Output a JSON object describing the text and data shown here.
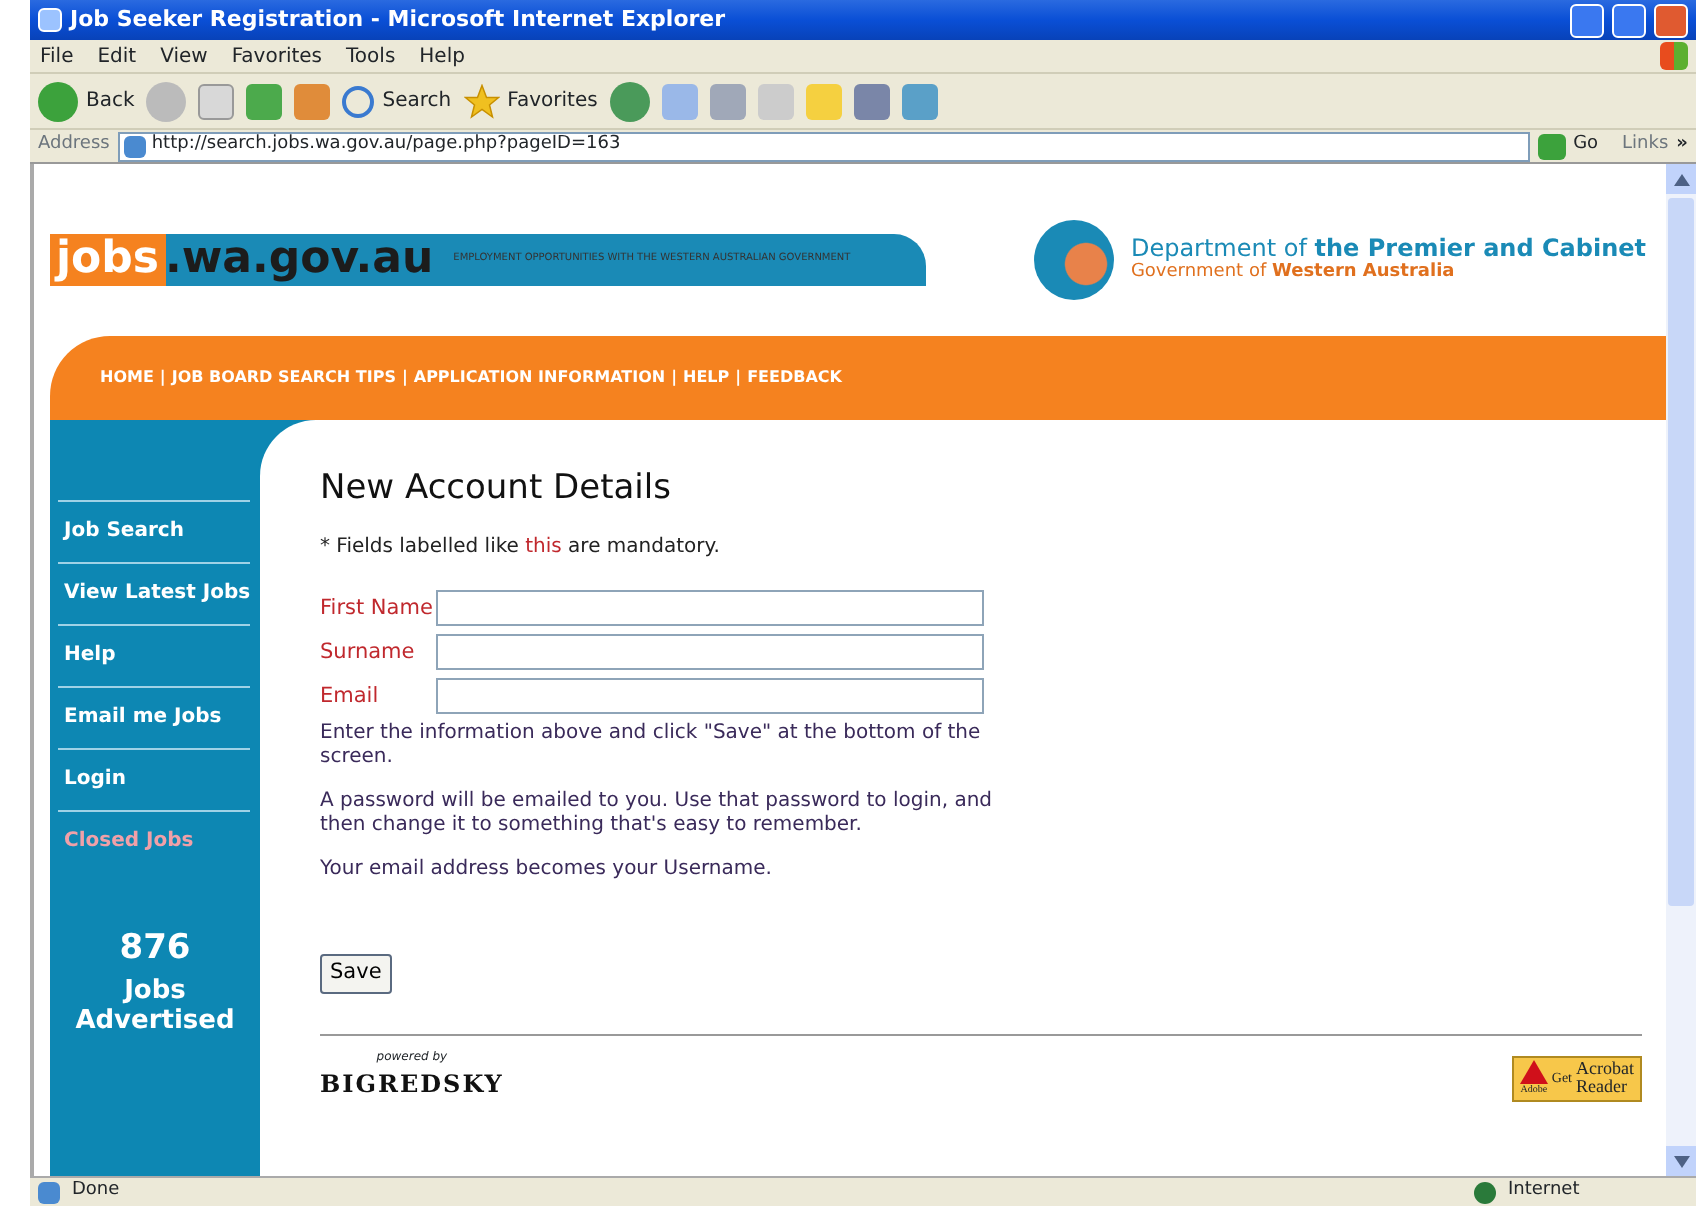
{
  "window": {
    "title": "Job Seeker Registration - Microsoft Internet Explorer"
  },
  "menu": [
    "File",
    "Edit",
    "View",
    "Favorites",
    "Tools",
    "Help"
  ],
  "toolbar": {
    "back": "Back",
    "search": "Search",
    "favorites": "Favorites"
  },
  "address": {
    "label": "Address",
    "url": "http://search.jobs.wa.gov.au/page.php?pageID=163",
    "go": "Go",
    "links": "Links",
    "more": "»"
  },
  "header": {
    "logo_main": "jobs",
    "logo_rest": ".wa.gov.au",
    "tagline": "EMPLOYMENT OPPORTUNITIES WITH THE WESTERN AUSTRALIAN GOVERNMENT",
    "dept_line1": "Department of **the Premier and Cabinet**",
    "dept_line2": "Government of **Western Australia**"
  },
  "nav_separator": "|",
  "nav": [
    "HOME",
    "JOB BOARD SEARCH TIPS",
    "APPLICATION INFORMATION",
    "HELP",
    "FEEDBACK"
  ],
  "sidebar": {
    "items": [
      {
        "label": "Job Search",
        "color": "#ffffff"
      },
      {
        "label": "View Latest Jobs",
        "color": "#ffffff"
      },
      {
        "label": "Help",
        "color": "#ffffff"
      },
      {
        "label": "Email me Jobs",
        "color": "#ffffff"
      },
      {
        "label": "Login",
        "color": "#ffffff"
      },
      {
        "label": "Closed Jobs",
        "color": "#f0a0a8"
      }
    ],
    "count": "876",
    "count_label": "Jobs Advertised"
  },
  "form": {
    "title": "New Account Details",
    "note": {
      "before": "* Fields labelled like",
      "highlight": "this",
      "after": "are mandatory."
    },
    "fields": [
      {
        "label": "First Name"
      },
      {
        "label": "Surname"
      },
      {
        "label": "Email"
      }
    ],
    "paragraphs": [
      "Enter the information above and click \"Save\" at the bottom of the screen.",
      "A password will be emailed to you. Use that password to login, and then change it to something that's easy to remember.",
      "Your email address becomes your Username."
    ],
    "save": "Save"
  },
  "footer": {
    "powered_by": "powered by",
    "brand": "BIGREDSKY",
    "badge": {
      "vendor": "Adobe",
      "get": "Get",
      "product1": "Acrobat",
      "product2": "Reader"
    }
  },
  "status_bar": {
    "text": "Done",
    "zone": "Internet"
  }
}
